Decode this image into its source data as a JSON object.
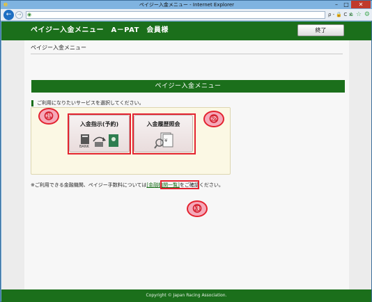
{
  "window": {
    "title": "ペイジー入金メニュー - Internet Explorer",
    "controls": {
      "minimize": "–",
      "maximize": "□",
      "close": "✕"
    }
  },
  "addressbar": {
    "back_glyph": "←",
    "forward_glyph": "→",
    "tools_text": "ρ - 🔒 C ×",
    "right_icons": [
      "⌂",
      "☆",
      "⚙"
    ]
  },
  "header": {
    "title": "ペイジー入金メニュー　A－PAT　会員様",
    "logout_label": "終了"
  },
  "breadcrumb": "ペイジー入金メニュー",
  "menu_title": "ペイジー入金メニュー",
  "instruction": "ご利用になりたいサービスを選択してください。",
  "services": [
    {
      "label": "入金指示(予約)",
      "icon": "bank-transfer-icon"
    },
    {
      "label": "入金履歴照会",
      "icon": "history-search-icon"
    }
  ],
  "note": {
    "prefix": "※ご利用できる金融機関、ペイジー手数料については",
    "link": "[金融機関一覧]",
    "suffix": "をご確認ください。"
  },
  "callouts": [
    "①",
    "②",
    "③"
  ],
  "footer": "Copyright © Japan Racing Association.",
  "colors": {
    "brand_green": "#1b6f1b",
    "highlight_red": "#e3232f"
  }
}
